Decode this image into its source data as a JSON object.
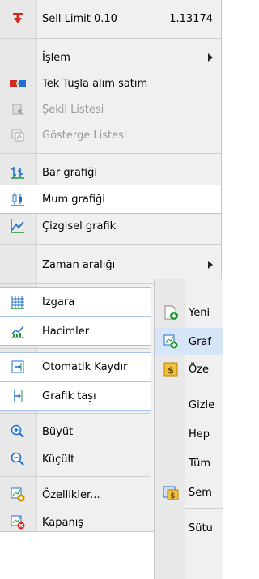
{
  "top": {
    "label": "Sell Limit 0.10",
    "price": "1.13174"
  },
  "menu": [
    {
      "label": "İşlem"
    },
    {
      "label": "Tek Tuşla alım satım"
    },
    {
      "label": "Şekil Listesi"
    },
    {
      "label": "Gösterge Listesi"
    },
    {
      "label": "Bar grafiği"
    },
    {
      "label": "Mum grafiği"
    },
    {
      "label": "Çizgisel grafik"
    },
    {
      "label": "Zaman aralığı"
    },
    {
      "label": "Izgara"
    },
    {
      "label": "Hacimler"
    },
    {
      "label": "Otomatik Kaydır"
    },
    {
      "label": "Grafik taşı"
    },
    {
      "label": "Büyüt"
    },
    {
      "label": "Küçült"
    },
    {
      "label": "Özellikler..."
    },
    {
      "label": "Kapanış"
    }
  ],
  "submenu": [
    {
      "label": "Yeni"
    },
    {
      "label": "Graf"
    },
    {
      "label": "Öze"
    },
    {
      "label": "Gizle"
    },
    {
      "label": "Hep"
    },
    {
      "label": "Tüm"
    },
    {
      "label": "Sem"
    },
    {
      "label": "Sütu"
    }
  ],
  "colors": {
    "accent": "#1f6fd1",
    "green": "#1c9a2b",
    "red": "#d3281e"
  }
}
